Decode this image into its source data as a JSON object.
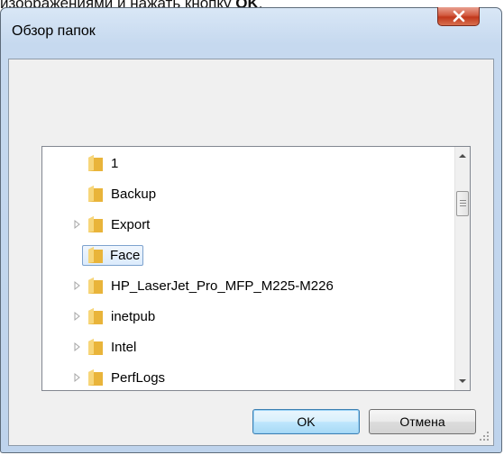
{
  "background_caption": {
    "text_before": "изображениями и нажать кнопку ",
    "text_bold": "OK",
    "text_after": "."
  },
  "dialog": {
    "title": "Обзор папок",
    "close_icon": "close-icon"
  },
  "tree": {
    "items": [
      {
        "label": "1",
        "has_children": false,
        "selected": false
      },
      {
        "label": "Backup",
        "has_children": false,
        "selected": false
      },
      {
        "label": "Export",
        "has_children": true,
        "selected": false
      },
      {
        "label": "Face",
        "has_children": false,
        "selected": true
      },
      {
        "label": "HP_LaserJet_Pro_MFP_M225-M226",
        "has_children": true,
        "selected": false
      },
      {
        "label": "inetpub",
        "has_children": true,
        "selected": false
      },
      {
        "label": "Intel",
        "has_children": true,
        "selected": false
      },
      {
        "label": "PerfLogs",
        "has_children": true,
        "selected": false
      }
    ]
  },
  "buttons": {
    "ok_label": "OK",
    "cancel_label": "Отмена"
  },
  "colors": {
    "folder": "#f2c24a",
    "selection_border": "#7da2ce",
    "close_button": "#c8432a"
  }
}
